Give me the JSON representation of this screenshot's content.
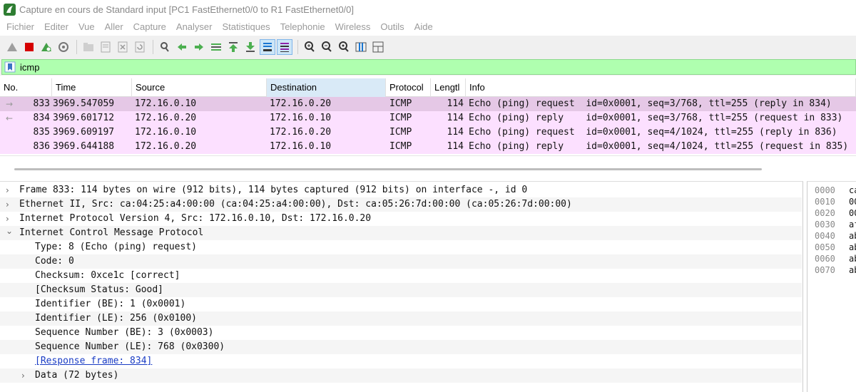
{
  "window": {
    "title": "Capture en cours de Standard input [PC1 FastEthernet0/0 to R1 FastEthernet0/0]"
  },
  "menu": [
    "Fichier",
    "Editer",
    "Vue",
    "Aller",
    "Capture",
    "Analyser",
    "Statistiques",
    "Telephonie",
    "Wireless",
    "Outils",
    "Aide"
  ],
  "toolbar": {
    "icons": [
      "shark-fin-start-icon",
      "stop-capture-icon",
      "restart-capture-icon",
      "capture-options-icon",
      "open-file-icon",
      "save-file-icon",
      "close-file-icon",
      "reload-file-icon",
      "find-packet-icon",
      "go-back-icon",
      "go-forward-icon",
      "go-to-packet-icon",
      "go-first-packet-icon",
      "go-last-packet-icon",
      "auto-scroll-icon",
      "colorize-icon",
      "zoom-in-icon",
      "zoom-out-icon",
      "zoom-normal-icon",
      "resize-columns-icon",
      "layout-icon"
    ]
  },
  "filter": {
    "value": "icmp",
    "color": "#afffaf"
  },
  "packet_list": {
    "columns": [
      "No.",
      "Time",
      "Source",
      "Destination",
      "Protocol",
      "Lengtl",
      "Info"
    ],
    "sorted_column": "Destination",
    "rows": [
      {
        "no": "833",
        "time": "3969.547059",
        "source": "172.16.0.10",
        "destination": "172.16.0.20",
        "protocol": "ICMP",
        "length": "114",
        "info": "Echo (ping) request  id=0x0001, seq=3/768, ttl=255 (reply in 834)",
        "arrow": "→",
        "selected": true
      },
      {
        "no": "834",
        "time": "3969.601712",
        "source": "172.16.0.20",
        "destination": "172.16.0.10",
        "protocol": "ICMP",
        "length": "114",
        "info": "Echo (ping) reply    id=0x0001, seq=3/768, ttl=255 (request in 833)",
        "arrow": "←",
        "selected": false
      },
      {
        "no": "835",
        "time": "3969.609197",
        "source": "172.16.0.10",
        "destination": "172.16.0.20",
        "protocol": "ICMP",
        "length": "114",
        "info": "Echo (ping) request  id=0x0001, seq=4/1024, ttl=255 (reply in 836)",
        "arrow": "",
        "selected": false
      },
      {
        "no": "836",
        "time": "3969.644188",
        "source": "172.16.0.20",
        "destination": "172.16.0.10",
        "protocol": "ICMP",
        "length": "114",
        "info": "Echo (ping) reply    id=0x0001, seq=4/1024, ttl=255 (request in 835)",
        "arrow": "",
        "selected": false
      }
    ],
    "row_color": "#fce0ff",
    "selected_color": "#e5c8e6"
  },
  "details": {
    "rows": [
      {
        "indent": 0,
        "expander": ">",
        "text": "Frame 833: 114 bytes on wire (912 bits), 114 bytes captured (912 bits) on interface -, id 0",
        "link": false
      },
      {
        "indent": 0,
        "expander": ">",
        "text": "Ethernet II, Src: ca:04:25:a4:00:00 (ca:04:25:a4:00:00), Dst: ca:05:26:7d:00:00 (ca:05:26:7d:00:00)",
        "link": false
      },
      {
        "indent": 0,
        "expander": ">",
        "text": "Internet Protocol Version 4, Src: 172.16.0.10, Dst: 172.16.0.20",
        "link": false
      },
      {
        "indent": 0,
        "expander": "v",
        "text": "Internet Control Message Protocol",
        "link": false
      },
      {
        "indent": 1,
        "expander": "",
        "text": "Type: 8 (Echo (ping) request)",
        "link": false
      },
      {
        "indent": 1,
        "expander": "",
        "text": "Code: 0",
        "link": false
      },
      {
        "indent": 1,
        "expander": "",
        "text": "Checksum: 0xce1c [correct]",
        "link": false
      },
      {
        "indent": 1,
        "expander": "",
        "text": "[Checksum Status: Good]",
        "link": false
      },
      {
        "indent": 1,
        "expander": "",
        "text": "Identifier (BE): 1 (0x0001)",
        "link": false
      },
      {
        "indent": 1,
        "expander": "",
        "text": "Identifier (LE): 256 (0x0100)",
        "link": false
      },
      {
        "indent": 1,
        "expander": "",
        "text": "Sequence Number (BE): 3 (0x0003)",
        "link": false
      },
      {
        "indent": 1,
        "expander": "",
        "text": "Sequence Number (LE): 768 (0x0300)",
        "link": false
      },
      {
        "indent": 1,
        "expander": "",
        "text": "[Response frame: 834]",
        "link": true
      },
      {
        "indent": 1,
        "expander": ">",
        "text": "Data (72 bytes)",
        "link": false
      }
    ]
  },
  "hex": {
    "rows": [
      {
        "offset": "0000",
        "bytes": "ca"
      },
      {
        "offset": "0010",
        "bytes": "00"
      },
      {
        "offset": "0020",
        "bytes": "00"
      },
      {
        "offset": "0030",
        "bytes": "af"
      },
      {
        "offset": "0040",
        "bytes": "ab"
      },
      {
        "offset": "0050",
        "bytes": "ab"
      },
      {
        "offset": "0060",
        "bytes": "ab"
      },
      {
        "offset": "0070",
        "bytes": "ab"
      }
    ]
  }
}
